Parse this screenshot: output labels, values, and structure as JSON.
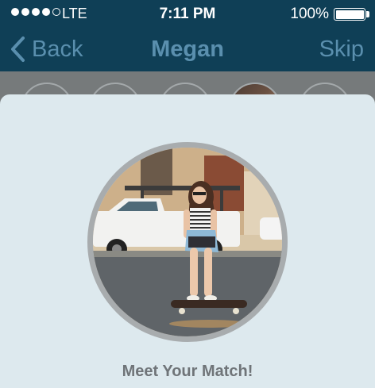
{
  "status_bar": {
    "carrier": "LTE",
    "time": "7:11 PM",
    "battery": "100%"
  },
  "nav": {
    "back_label": "Back",
    "title": "Megan",
    "skip_label": "Skip"
  },
  "match": {
    "heading": "Meet Your Match!"
  },
  "colors": {
    "nav_background": "#0f3f56",
    "nav_text": "#5a8fae",
    "card_background": "#dde9ee",
    "photo_ring": "#a8acae"
  }
}
